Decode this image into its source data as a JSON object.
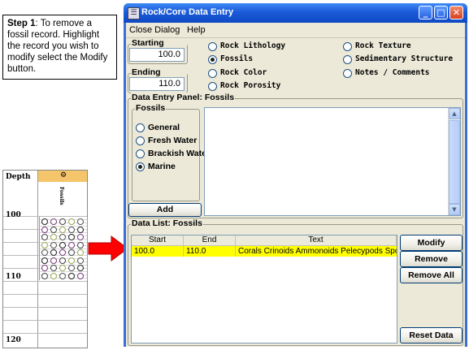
{
  "instruction": {
    "step_label": "Step 1",
    "text": ": To remove a fossil record.  Highlight the record you wish to modify select the Modify button."
  },
  "strip_log": {
    "depth_header": "Depth",
    "column_label": "Fossils",
    "depth_ticks": [
      "100",
      "110",
      "120"
    ]
  },
  "window": {
    "title": "Rock/Core Data Entry",
    "controls": {
      "minimize": "_",
      "maximize": "□",
      "close": "✕"
    }
  },
  "menu": [
    "Close Dialog",
    "Help"
  ],
  "depth": {
    "starting_label": "Starting Depth:",
    "starting_value": "100.0",
    "ending_label": "Ending Depth:",
    "ending_value": "110.0"
  },
  "categories": {
    "col1": [
      "Rock Lithology",
      "Fossils",
      "Rock Color",
      "Rock Porosity"
    ],
    "col2": [
      "Rock Texture",
      "Sedimentary Structure",
      "Notes / Comments"
    ],
    "selected": "Fossils"
  },
  "entry_panel": {
    "title": "Data Entry Panel: Fossils",
    "group_title": "Fossils",
    "options": [
      "General",
      "Fresh Water",
      "Brackish Water",
      "Marine"
    ],
    "selected": "Marine",
    "add_label": "Add"
  },
  "data_list": {
    "title": "Data List: Fossils",
    "columns": [
      "Start",
      "End",
      "Text"
    ],
    "rows": [
      {
        "start": "100.0",
        "end": "110.0",
        "text": "Corals Crinoids Ammonoids Pelecypods Spo..."
      }
    ],
    "buttons": [
      "Modify",
      "Remove",
      "Remove All",
      "Reset Data"
    ]
  },
  "colors": {
    "title_bar": "#1b5ad8",
    "selected_row": "#ffff00",
    "arrow": "#ff0000",
    "strip_header": "#f5c56b"
  }
}
